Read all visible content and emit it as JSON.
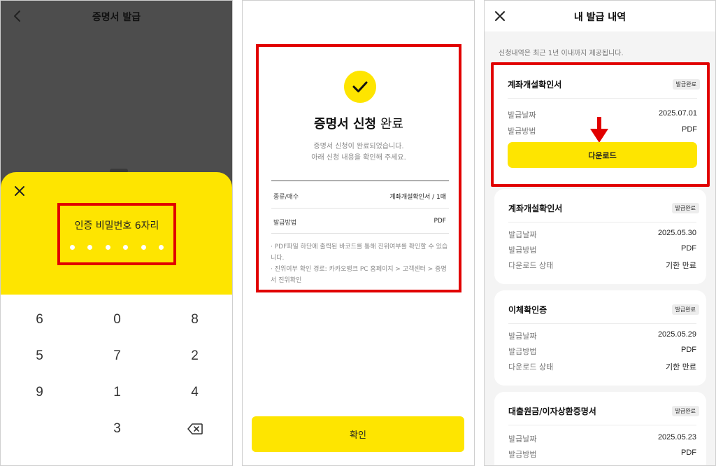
{
  "panel1": {
    "title": "증명서 발급",
    "pin_label": "인증 비밀번호 6자리",
    "pin_length": 6,
    "keypad": [
      "6",
      "0",
      "8",
      "5",
      "7",
      "2",
      "9",
      "1",
      "4",
      "3"
    ]
  },
  "panel2": {
    "title_bold": "증명서 신청",
    "title_rest": " 완료",
    "desc_line1": "증명서 신청이 완료되었습니다.",
    "desc_line2": "아래 신청 내용을 확인해 주세요.",
    "rows": [
      {
        "label": "종류/매수",
        "value": "계좌개설확인서 / 1매"
      },
      {
        "label": "발급방법",
        "value": "PDF"
      }
    ],
    "notes": [
      "· PDF파일 하단에 출력된 바코드를 통해 진위여부를 확인할 수 있습니다.",
      "· 진위여부 확인 경로: 카카오뱅크 PC 홈페이지 > 고객센터 > 증명서 진위확인"
    ],
    "confirm_label": "확인"
  },
  "panel3": {
    "title": "내 발급 내역",
    "notice": "신청내역은 최근 1년 이내까지 제공됩니다.",
    "download_label": "다운로드",
    "cards": [
      {
        "title": "계좌개설확인서",
        "badge": "발급완료",
        "rows": [
          {
            "label": "발급날짜",
            "value": "2025.07.01"
          },
          {
            "label": "발급방법",
            "value": "PDF"
          }
        ]
      },
      {
        "title": "계좌개설확인서",
        "badge": "발급완료",
        "rows": [
          {
            "label": "발급날짜",
            "value": "2025.05.30"
          },
          {
            "label": "발급방법",
            "value": "PDF"
          },
          {
            "label": "다운로드 상태",
            "value": "기한 만료"
          }
        ]
      },
      {
        "title": "이체확인증",
        "badge": "발급완료",
        "rows": [
          {
            "label": "발급날짜",
            "value": "2025.05.29"
          },
          {
            "label": "발급방법",
            "value": "PDF"
          },
          {
            "label": "다운로드 상태",
            "value": "기한 만료"
          }
        ]
      },
      {
        "title": "대출원금/이자상환증명서",
        "badge": "발급완료",
        "rows": [
          {
            "label": "발급날짜",
            "value": "2025.05.23"
          },
          {
            "label": "발급방법",
            "value": "PDF"
          }
        ]
      }
    ]
  },
  "colors": {
    "accent_yellow": "#fee500",
    "highlight_red": "#e10000",
    "dim_background": "#4d4d4d"
  },
  "icons": {
    "back": "chevron-left-icon",
    "close": "close-icon",
    "backspace": "backspace-icon",
    "check": "check-icon",
    "annotation": "red-arrow-down-icon"
  }
}
